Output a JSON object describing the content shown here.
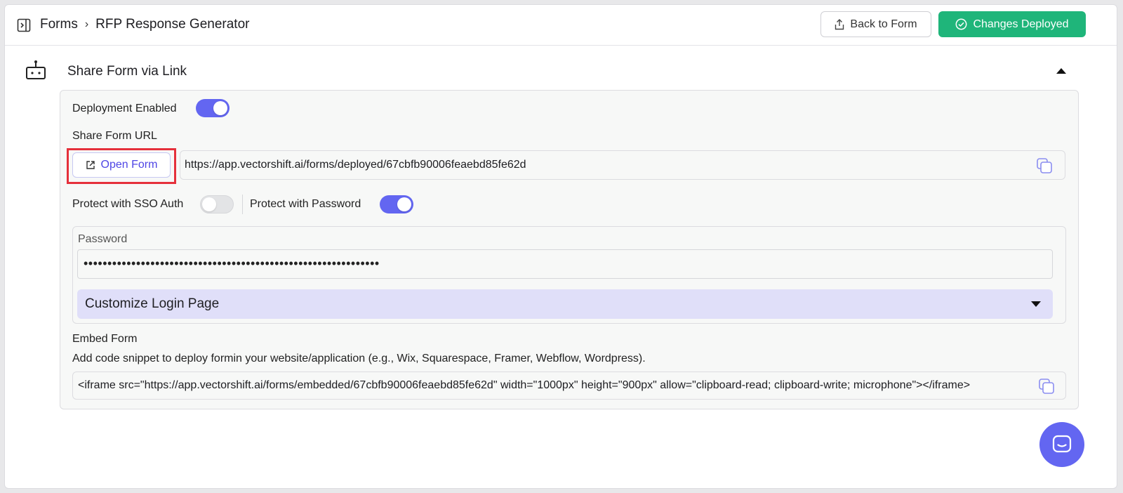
{
  "header": {
    "breadcrumb_root": "Forms",
    "breadcrumb_separator": "›",
    "breadcrumb_current": "RFP Response Generator",
    "back_button_label": "Back to Form",
    "deployed_button_label": "Changes Deployed"
  },
  "section": {
    "title": "Share Form via Link"
  },
  "deployment": {
    "enabled_label": "Deployment Enabled",
    "enabled": true
  },
  "share_url": {
    "label": "Share Form URL",
    "open_button_label": "Open Form",
    "url": "https://app.vectorshift.ai/forms/deployed/67cbfb90006feaebd85fe62d"
  },
  "protection": {
    "sso_label": "Protect with SSO Auth",
    "sso_enabled": false,
    "password_label": "Protect with Password",
    "password_enabled": true
  },
  "password": {
    "label": "Password",
    "masked_value": "••••••••••••••••••••••••••••••••••••••••••••••••••••••••••••••",
    "customize_label": "Customize Login Page"
  },
  "embed": {
    "title": "Embed Form",
    "description": "Add code snippet to deploy formin your website/application (e.g., Wix, Squarespace, Framer, Webflow, Wordpress).",
    "code": "<iframe src=\"https://app.vectorshift.ai/forms/embedded/67cbfb90006feaebd85fe62d\" width=\"1000px\" height=\"900px\" allow=\"clipboard-read; clipboard-write; microphone\"></iframe>"
  },
  "colors": {
    "accent": "#6366f1",
    "deployed_green": "#1fb57a",
    "highlight_red": "#e5303b",
    "customize_bg": "#e0dff9"
  }
}
